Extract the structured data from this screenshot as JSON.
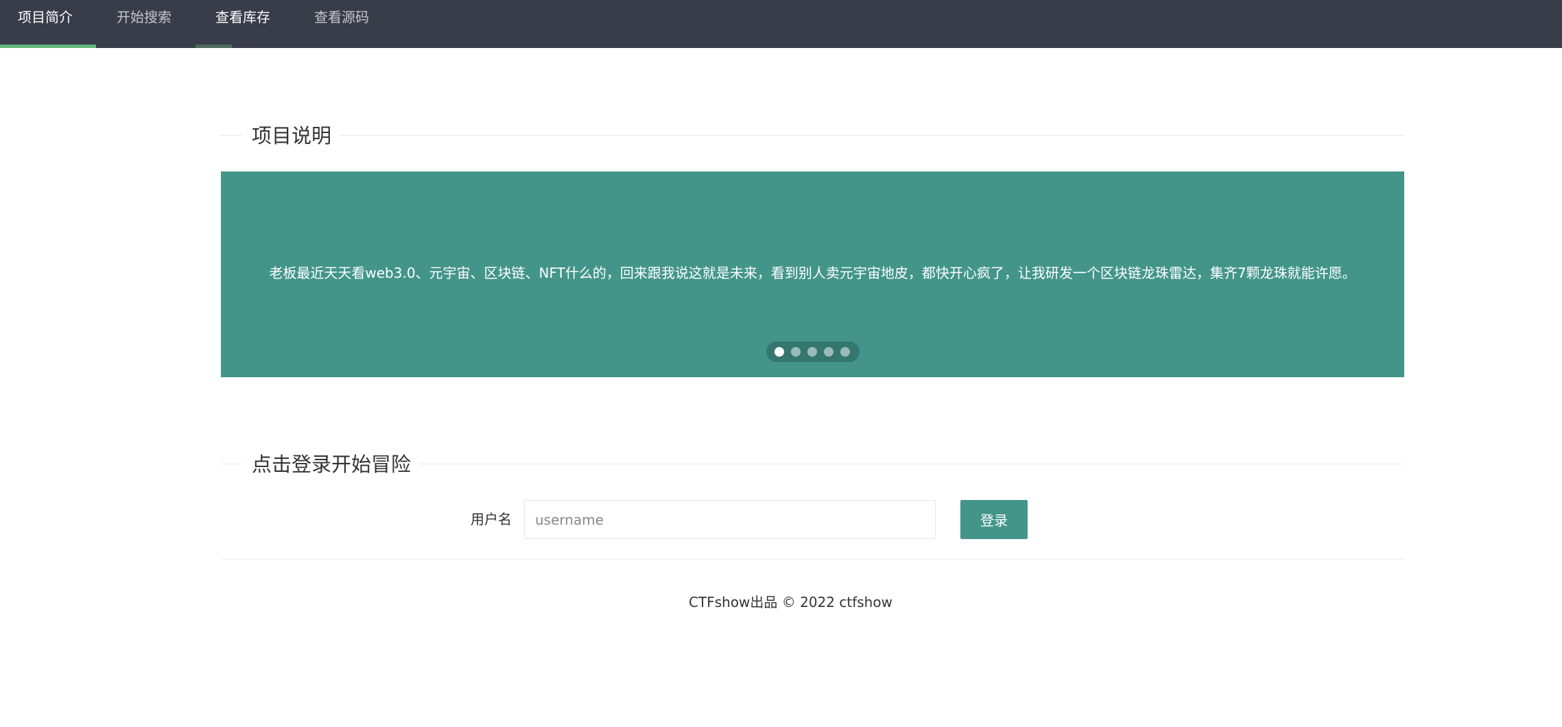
{
  "nav": {
    "items": [
      {
        "label": "项目简介",
        "active": true
      },
      {
        "label": "开始搜索",
        "active": false
      },
      {
        "label": "查看库存",
        "active": false
      },
      {
        "label": "查看源码",
        "active": false
      }
    ]
  },
  "sections": {
    "intro_title": "项目说明",
    "login_title": "点击登录开始冒险"
  },
  "carousel": {
    "text": "老板最近天天看web3.0、元宇宙、区块链、NFT什么的，回来跟我说这就是未来，看到别人卖元宇宙地皮，都快开心疯了，让我研发一个区块链龙珠雷达，集齐7颗龙珠就能许愿。",
    "slide_count": 5,
    "active_slide": 1,
    "background_color": "#43958a"
  },
  "login": {
    "username_label": "用户名",
    "username_placeholder": "username",
    "username_value": "",
    "submit_label": "登录"
  },
  "footer": {
    "text": "CTFshow出品 © 2022 ctfshow"
  },
  "colors": {
    "nav_background": "#393d49",
    "accent_green": "#5fb878",
    "accent_teal": "#43958a",
    "hover_dark_green": "#4e6b5d"
  }
}
